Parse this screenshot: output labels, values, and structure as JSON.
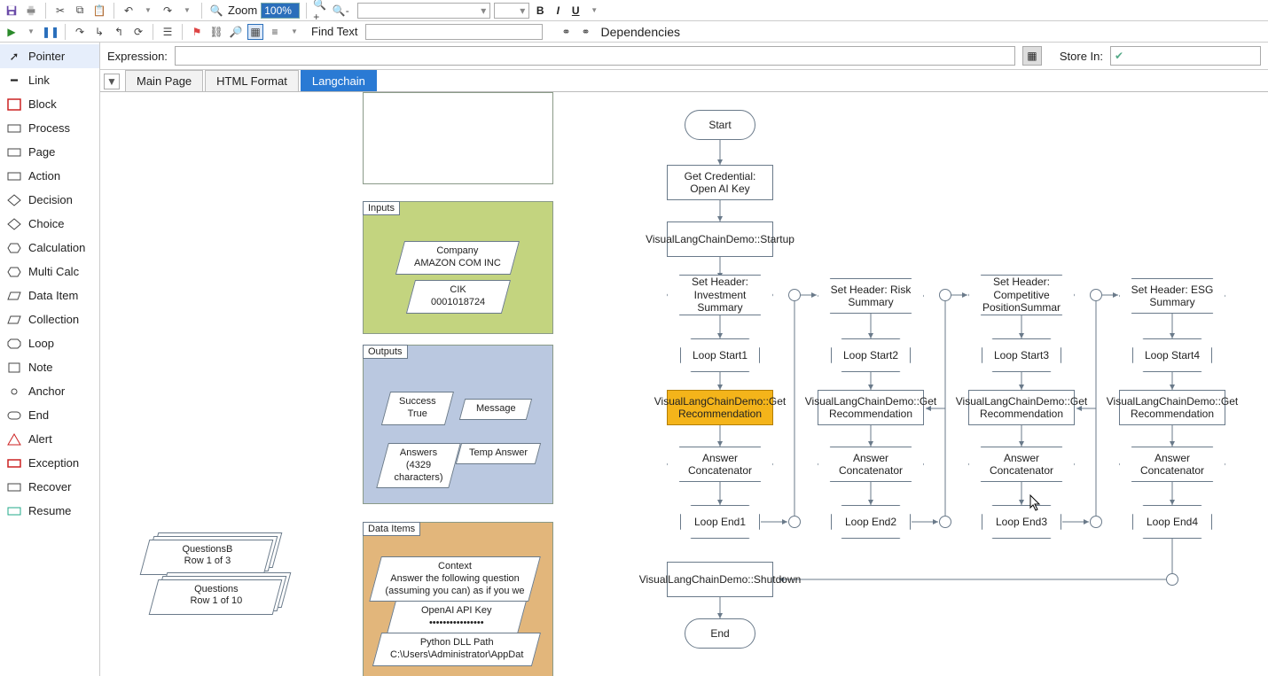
{
  "toolbar": {
    "zoom_label": "Zoom",
    "zoom_value": "100%",
    "bold": "B",
    "italic": "I",
    "underline": "U",
    "find_label": "Find Text",
    "deps_label": "Dependencies"
  },
  "sidebar": {
    "items": [
      {
        "label": "Pointer"
      },
      {
        "label": "Link"
      },
      {
        "label": "Block"
      },
      {
        "label": "Process"
      },
      {
        "label": "Page"
      },
      {
        "label": "Action"
      },
      {
        "label": "Decision"
      },
      {
        "label": "Choice"
      },
      {
        "label": "Calculation"
      },
      {
        "label": "Multi Calc"
      },
      {
        "label": "Data Item"
      },
      {
        "label": "Collection"
      },
      {
        "label": "Loop"
      },
      {
        "label": "Note"
      },
      {
        "label": "Anchor"
      },
      {
        "label": "End"
      },
      {
        "label": "Alert"
      },
      {
        "label": "Exception"
      },
      {
        "label": "Recover"
      },
      {
        "label": "Resume"
      }
    ]
  },
  "expr": {
    "label": "Expression:",
    "store_label": "Store In:"
  },
  "tabs": {
    "items": [
      {
        "label": "Main Page"
      },
      {
        "label": "HTML Format"
      },
      {
        "label": "Langchain"
      }
    ],
    "active": 2
  },
  "sections": {
    "inputs_label": "Inputs",
    "outputs_label": "Outputs",
    "dataitems_label": "Data Items",
    "company": "Company\nAMAZON COM INC",
    "cik": "CIK\n0001018724",
    "success": "Success\nTrue",
    "message": "Message",
    "answers": "Answers\n(4329 characters)",
    "temp": "Temp Answer",
    "context": "Context\nAnswer the following question (assuming you can) as if you we",
    "apikey": "OpenAI API Key\n••••••••••••••••",
    "dllpath": "Python DLL Path\nC:\\Users\\Administrator\\AppDat",
    "qb": "QuestionsB\nRow 1 of 3",
    "q": "Questions\nRow 1 of 10"
  },
  "flow": {
    "start": "Start",
    "end": "End",
    "cred": "Get Credential: Open AI Key",
    "startup": "VisualLangChainDemo::Startup",
    "shutdown": "VisualLangChainDemo::Shutdown",
    "hdr1": "Set Header: Investment Summary",
    "hdr2": "Set Header: Risk Summary",
    "hdr3": "Set Header: Competitive PositionSummar",
    "hdr4": "Set Header: ESG Summary",
    "ls1": "Loop Start1",
    "ls2": "Loop Start2",
    "ls3": "Loop Start3",
    "ls4": "Loop Start4",
    "le1": "Loop End1",
    "le2": "Loop End2",
    "le3": "Loop End3",
    "le4": "Loop End4",
    "rec": "VisualLangChainDemo::Get Recommendation",
    "ac": "Answer Concatenator"
  }
}
